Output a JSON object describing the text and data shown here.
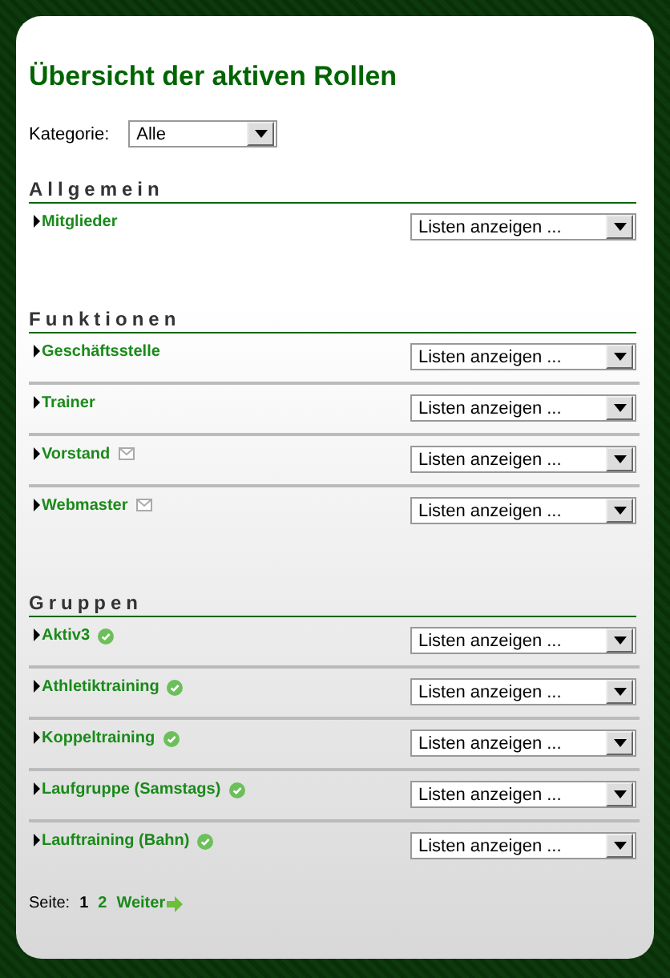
{
  "title": "Übersicht der aktiven Rollen",
  "category": {
    "label": "Kategorie:",
    "value": "Alle"
  },
  "sections": [
    {
      "heading": "Allgemein",
      "roles": [
        {
          "name": "Mitglieder",
          "kind": "plain",
          "list_select": "Listen anzeigen ..."
        }
      ]
    },
    {
      "heading": "Funktionen",
      "roles": [
        {
          "name": "Geschäftsstelle",
          "kind": "plain",
          "list_select": "Listen anzeigen ..."
        },
        {
          "name": "Trainer",
          "kind": "plain",
          "list_select": "Listen anzeigen ..."
        },
        {
          "name": "Vorstand",
          "kind": "mail",
          "list_select": "Listen anzeigen ..."
        },
        {
          "name": "Webmaster",
          "kind": "mail",
          "list_select": "Listen anzeigen ..."
        }
      ]
    },
    {
      "heading": "Gruppen",
      "roles": [
        {
          "name": "Aktiv3",
          "kind": "active",
          "list_select": "Listen anzeigen ..."
        },
        {
          "name": "Athletiktraining",
          "kind": "active",
          "list_select": "Listen anzeigen ..."
        },
        {
          "name": "Koppeltraining",
          "kind": "active",
          "list_select": "Listen anzeigen ..."
        },
        {
          "name": "Laufgruppe (Samstags)",
          "kind": "active",
          "list_select": "Listen anzeigen ..."
        },
        {
          "name": "Lauftraining (Bahn)",
          "kind": "active",
          "list_select": "Listen anzeigen ..."
        }
      ]
    }
  ],
  "pagination": {
    "label": "Seite:",
    "pages": [
      {
        "label": "1",
        "selected": true
      },
      {
        "label": "2",
        "selected": false
      }
    ],
    "next": "Weiter"
  }
}
